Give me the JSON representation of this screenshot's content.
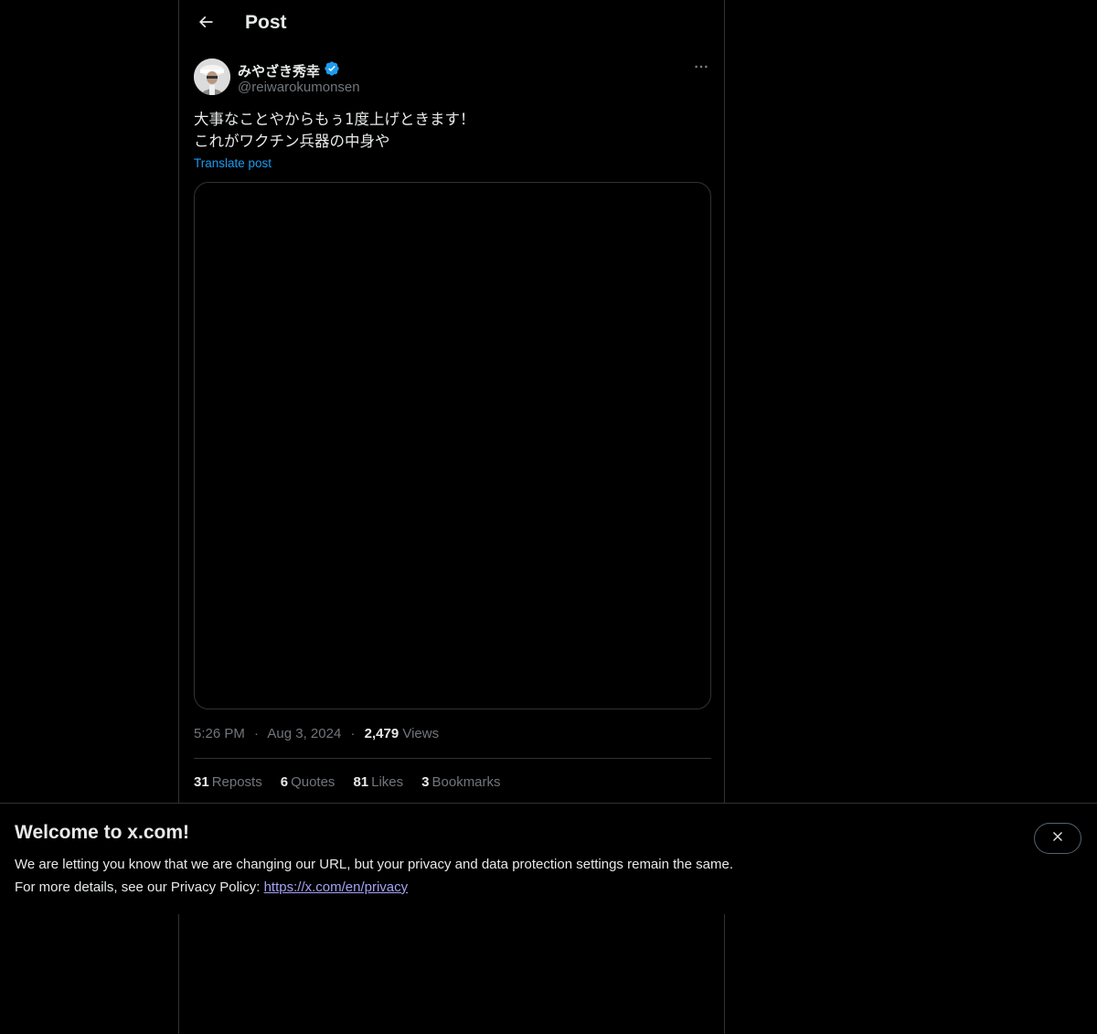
{
  "header": {
    "title": "Post",
    "back_icon": "arrow-left-icon"
  },
  "author": {
    "display_name": "みやざき秀幸",
    "handle": "@reiwarokumonsen",
    "verified": true,
    "verified_color": "#1d9bf0",
    "more_icon": "more-horizontal-icon"
  },
  "post": {
    "text_lines": [
      "大事なことやからもぅ1度上げときます！",
      "これがワクチン兵器の中身や"
    ],
    "translate_label": "Translate post"
  },
  "meta": {
    "time": "5:26 PM",
    "separator": "·",
    "date": "Aug 3, 2024",
    "views_count": "2,479",
    "views_label": "Views"
  },
  "stats": [
    {
      "count": "31",
      "label": "Reposts"
    },
    {
      "count": "6",
      "label": "Quotes"
    },
    {
      "count": "81",
      "label": "Likes"
    },
    {
      "count": "3",
      "label": "Bookmarks"
    }
  ],
  "banner": {
    "title": "Welcome to x.com!",
    "line1": "We are letting you know that we are changing our URL, but your privacy and data protection settings remain the same.",
    "line2_prefix": "For more details, see our Privacy Policy: ",
    "link_text": "https://x.com/en/privacy",
    "close_icon": "close-icon"
  },
  "colors": {
    "background": "#000000",
    "text_primary": "#e7e9ea",
    "text_secondary": "#71767b",
    "accent": "#1d9bf0",
    "border": "#2f3336",
    "link": "#a7a2f5"
  }
}
